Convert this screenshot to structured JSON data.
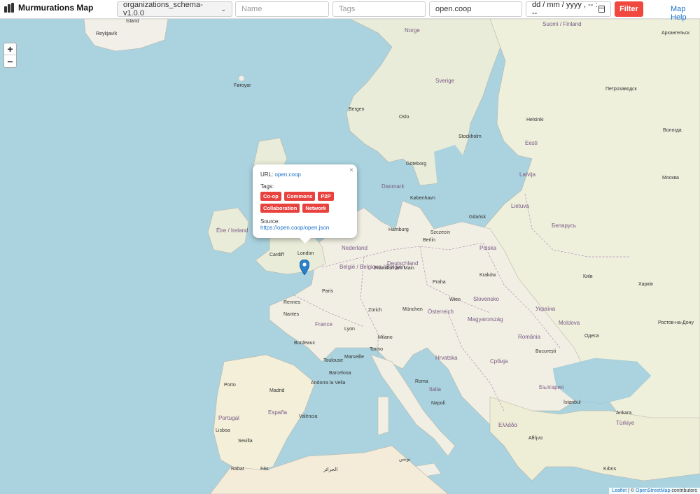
{
  "app": {
    "title": "Murmurations Map"
  },
  "filters": {
    "schema_value": "organizations_schema-v1.0.0",
    "name_placeholder": "Name",
    "tags_placeholder": "Tags",
    "domain_value": "open.coop",
    "date_placeholder": "dd / mm / yyyy ,  -- : --",
    "filter_label": "Filter",
    "help_label": "Map Help"
  },
  "zoom": {
    "in_label": "+",
    "out_label": "−"
  },
  "popup": {
    "close_label": "×",
    "url_label": "URL:",
    "url_value": "open.coop",
    "tags_label": "Tags:",
    "tags": [
      "Co-op",
      "Commons",
      "P2P",
      "Collaboration",
      "Network"
    ],
    "source_label": "Source:",
    "source_value": "https://open.coop/open.json"
  },
  "attribution": {
    "leaflet": "Leaflet",
    "sep": " | © ",
    "osm": "OpenStreetMap",
    "suffix": " contributors"
  },
  "place_labels": {
    "island": "Ísland",
    "reykjavik": "Reykjavík",
    "faroe": "Føroyar",
    "norge": "Norge",
    "sverige": "Sverige",
    "suomi": "Suomi / Finland",
    "arkhangelsk": "Архангельск",
    "petrozavodsk": "Петрозаводск",
    "bergen": "Bergen",
    "oslo": "Oslo",
    "stockholm": "Stockholm",
    "helsinki": "Helsinki",
    "vologda": "Вологда",
    "eesti": "Eesti",
    "latvija": "Latvija",
    "moskva": "Москва",
    "goteborg": "Göteborg",
    "danmark": "Danmark",
    "kobenhavn": "København",
    "lietuva": "Lietuva",
    "belarus": "Беларусь",
    "eire": "Éire / Ireland",
    "hamburg": "Hamburg",
    "szczecin": "Szczecin",
    "gdansk": "Gdańsk",
    "nederland": "Nederland",
    "berlin": "Berlin",
    "polska": "Polska",
    "deutschland": "Deutschland",
    "cardiff": "Cardiff",
    "london": "London",
    "belgie": "België / Belgique / Belgien",
    "paris": "Paris",
    "france": "France",
    "rennes": "Rennes",
    "nantes": "Nantes",
    "wien": "Wien",
    "osterreich": "Österreich",
    "munchen": "München",
    "slovensko": "Slovensko",
    "magyarorszag": "Magyarország",
    "ukraina": "Україна",
    "kyiv": "Київ",
    "moldova": "Moldova",
    "romania": "România",
    "bucuresti": "București",
    "srbija": "Србија",
    "hrvatska": "Hrvatska",
    "italia": "Italia",
    "roma": "Roma",
    "napoli": "Napoli",
    "espana": "España",
    "portugal": "Portugal",
    "madrid": "Madrid",
    "lisboa": "Lisboa",
    "sevilla": "Sevilla",
    "barcelona": "Barcelona",
    "andorra": "Andorra la Vella",
    "bulgaria": "България",
    "turkiye": "Türkiye",
    "ankara": "Ankara",
    "istanbul": "İstanbul",
    "ellada": "Ελλάδα",
    "athina": "Αθήνα",
    "kibris": "Kıbrıs",
    "rostov": "Ростов-на-Дону",
    "kharkiv": "Харків",
    "odesa": "Одеса",
    "krakow": "Kraków",
    "praha": "Praha",
    "frankfurt": "Frankfurt am Main",
    "zurich": "Zürich",
    "marseille": "Marseille",
    "lyon": "Lyon",
    "milano": "Milano",
    "torino": "Torino",
    "porto": "Porto",
    "bordeaux": "Bordeaux",
    "toulouse": "Toulouse",
    "valencia": "València",
    "alger": "الجزائر",
    "tunis": "تونس",
    "rabat": "Rabat",
    "fes": "Fès"
  }
}
